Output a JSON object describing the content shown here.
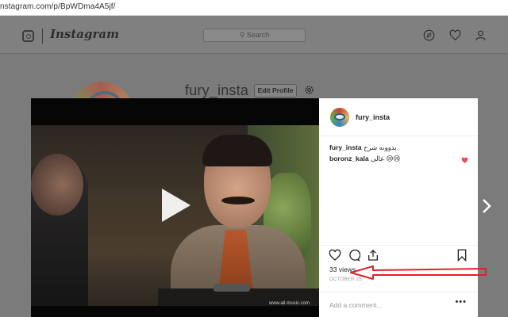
{
  "browser": {
    "url": "nstagram.com/p/BpWDma4A5jf/"
  },
  "header": {
    "logo_text": "Instagram",
    "search_placeholder": "Search",
    "icons": [
      "compass-icon",
      "heart-icon",
      "user-icon"
    ]
  },
  "profile": {
    "username": "fury_insta",
    "edit_button": "Edit Profile"
  },
  "post": {
    "username": "fury_insta",
    "comments": [
      {
        "user": "fury_insta",
        "text": "بدوونه شرح"
      },
      {
        "user": "boronz_kala",
        "text": "عالی 😢😢"
      }
    ],
    "views": "33 views",
    "date": "OCTOBER 25",
    "add_comment_placeholder": "Add a comment...",
    "more": "•••",
    "video_watermark": "www.all-music.com"
  },
  "colors": {
    "overlay": "#7b7b7b",
    "annotation": "#e0212a",
    "like_red": "#ed4956"
  }
}
